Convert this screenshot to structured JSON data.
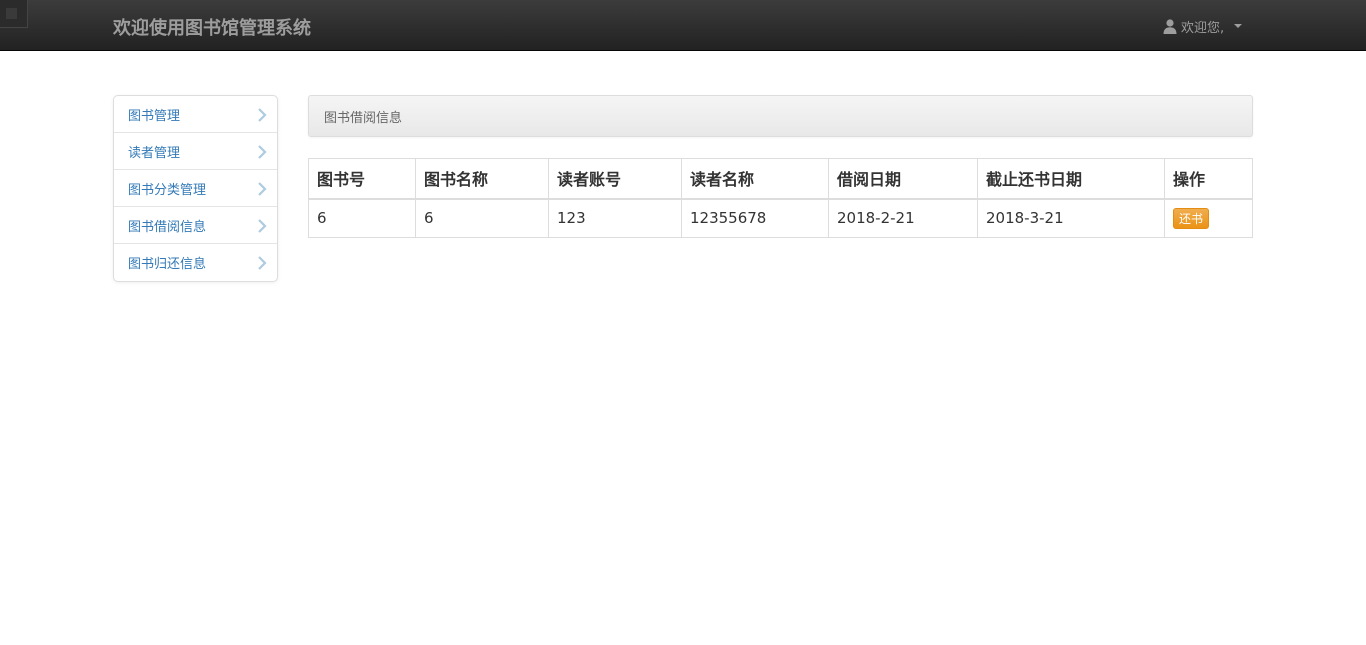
{
  "navbar": {
    "brand": "欢迎使用图书馆管理系统",
    "user_greeting": "欢迎您,"
  },
  "sidebar": {
    "items": [
      {
        "label": "图书管理"
      },
      {
        "label": "读者管理"
      },
      {
        "label": "图书分类管理"
      },
      {
        "label": "图书借阅信息"
      },
      {
        "label": "图书归还信息"
      }
    ]
  },
  "main": {
    "panel_title": "图书借阅信息",
    "table": {
      "headers": [
        "图书号",
        "图书名称",
        "读者账号",
        "读者名称",
        "借阅日期",
        "截止还书日期",
        "操作"
      ],
      "rows": [
        {
          "book_id": "6",
          "book_name": "6",
          "reader_account": "123",
          "reader_name": "12355678",
          "borrow_date": "2018-2-21",
          "due_date": "2018-3-21",
          "action_label": "还书"
        }
      ]
    }
  },
  "colors": {
    "navbar_bg": "#222222",
    "link": "#337ab7",
    "warning": "#f0ad4e"
  }
}
